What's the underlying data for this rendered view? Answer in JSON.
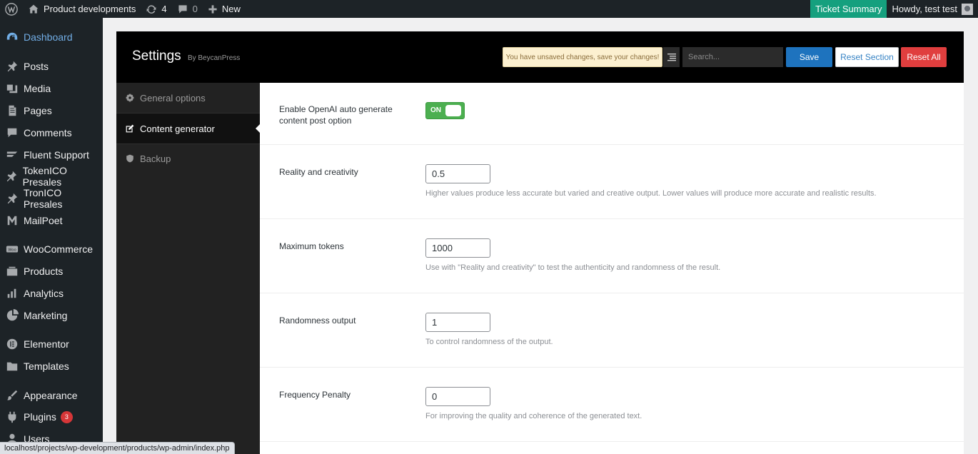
{
  "adminbar": {
    "site_name": "Product developments",
    "updates_count": "4",
    "comments_count": "0",
    "new_label": "New",
    "ticket_summary": "Ticket Summary",
    "howdy": "Howdy, test test"
  },
  "menu": {
    "items": [
      {
        "label": "Dashboard",
        "icon": "dashboard-icon"
      },
      {
        "label": "Posts",
        "icon": "pin-icon"
      },
      {
        "label": "Media",
        "icon": "media-icon"
      },
      {
        "label": "Pages",
        "icon": "pages-icon"
      },
      {
        "label": "Comments",
        "icon": "comments-icon"
      },
      {
        "label": "Fluent Support",
        "icon": "fluent-support-icon"
      },
      {
        "label": "TokenICO Presales",
        "icon": "pin-icon"
      },
      {
        "label": "TronICO Presales",
        "icon": "pin-icon"
      },
      {
        "label": "MailPoet",
        "icon": "mailpoet-icon"
      },
      {
        "label": "WooCommerce",
        "icon": "woocommerce-icon"
      },
      {
        "label": "Products",
        "icon": "products-icon"
      },
      {
        "label": "Analytics",
        "icon": "analytics-icon"
      },
      {
        "label": "Marketing",
        "icon": "marketing-icon"
      },
      {
        "label": "Elementor",
        "icon": "elementor-icon"
      },
      {
        "label": "Templates",
        "icon": "folder-icon"
      },
      {
        "label": "Appearance",
        "icon": "brush-icon"
      },
      {
        "label": "Plugins",
        "icon": "plugin-icon",
        "badge": "3"
      },
      {
        "label": "Users",
        "icon": "users-icon"
      }
    ]
  },
  "statusbar": {
    "url": "localhost/projects/wp-development/products/wp-admin/index.php"
  },
  "settings": {
    "title": "Settings",
    "by": "By BeycanPress",
    "notice": "You have unsaved changes, save your changes!",
    "search_placeholder": "Search...",
    "save": "Save",
    "reset_section": "Reset Section",
    "reset_all": "Reset All",
    "nav": [
      {
        "label": "General options",
        "icon": "gear-icon"
      },
      {
        "label": "Content generator",
        "icon": "edit-icon"
      },
      {
        "label": "Backup",
        "icon": "shield-icon"
      }
    ]
  },
  "fields": {
    "enable": {
      "label": "Enable OpenAI auto generate content post option",
      "toggle": "ON"
    },
    "reality": {
      "label": "Reality and creativity",
      "value": "0.5",
      "help": "Higher values produce less accurate but varied and creative output. Lower values will produce more accurate and realistic results."
    },
    "tokens": {
      "label": "Maximum tokens",
      "value": "1000",
      "help": "Use with \"Reality and creativity\" to test the authenticity and randomness of the result."
    },
    "randomness": {
      "label": "Randomness output",
      "value": "1",
      "help": "To control randomness of the output."
    },
    "frequency": {
      "label": "Frequency Penalty",
      "value": "0",
      "help": "For improving the quality and coherence of the generated text."
    }
  },
  "colors": {
    "adminbar_bg": "#1d2327",
    "menu_current": "#72aee6",
    "ticket_bg": "#15a07e",
    "save_bg": "#1e73be",
    "reset_all_bg": "#e03e3e",
    "toggle_on": "#4caf50"
  }
}
